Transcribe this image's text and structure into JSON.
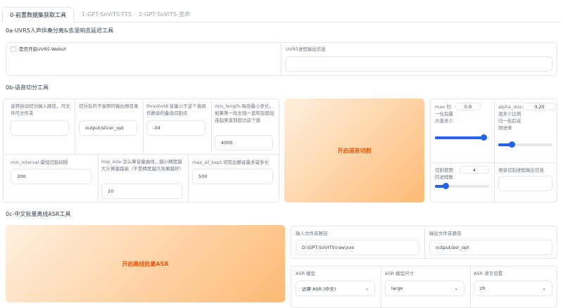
{
  "tabs": [
    "0-前置数据集获取工具",
    "1-GPT-SoVITS-TTS",
    "2-GPT-SoVITS-变声"
  ],
  "uvr": {
    "title": "0a-UVR5人声伴奏分离&去混响去延迟工具",
    "checkbox_label": "是否开启UVR5-WebUI",
    "checked": false,
    "output_label": "UVR5进程输出信息",
    "output_value": ""
  },
  "slicer": {
    "title": "0b-语音切分工具",
    "input_label": "音频自动切分输入路径，可文件可文件夹",
    "input_value": "",
    "output_label": "切分后的子音频的输出根目录",
    "output_value": "output/slicer_opt",
    "threshold_label": "threshold:音量小于这个值视作静音的备选切割点",
    "threshold_value": "-34",
    "min_length_label": "min_length:每段最小多长，如果第一段太短一直和后面段连起来直到超过这个值",
    "min_length_value": "4000",
    "min_interval_label": "min_interval:最短切割间隔",
    "min_interval_value": "300",
    "hop_size_label": "hop_size:怎么算音量曲线，越小精度越大计算量越高（不是精度越大效果越好）",
    "hop_size_value": "10",
    "max_sil_label": "max_sil_kept:切完后静音最多留多长",
    "max_sil_value": "500",
    "button": "开启语音切割",
    "max_label": "max:归一化后最大值多少",
    "max_value": "0.9",
    "max_fraction": 0.9,
    "alpha_label": "alpha_mix:混多少比例归一化后音频进来",
    "alpha_value": "0.25",
    "alpha_fraction": 0.25,
    "procs_label": "切割使用的进程数",
    "procs_value": "4",
    "procs_fraction": 0.2,
    "info_label": "语音切割进程输出信息",
    "info_value": ""
  },
  "asr": {
    "title": "0c-中文批量离线ASR工具",
    "button": "开启离线批量ASR",
    "in_label": "输入文件夹路径",
    "in_value": "D:\\GPT-SoVITS\\raw\\xxx",
    "out_label": "输出文件夹路径",
    "out_value": "output/asr_opt",
    "model_label": "ASR 模型",
    "model_value": "达摩 ASR (中文)",
    "size_label": "ASR 模型尺寸",
    "size_value": "large",
    "lang_label": "ASR 语言设置",
    "lang_value": "zh"
  },
  "colors": {
    "accent": "#2563eb",
    "button_text": "#ea580c"
  }
}
